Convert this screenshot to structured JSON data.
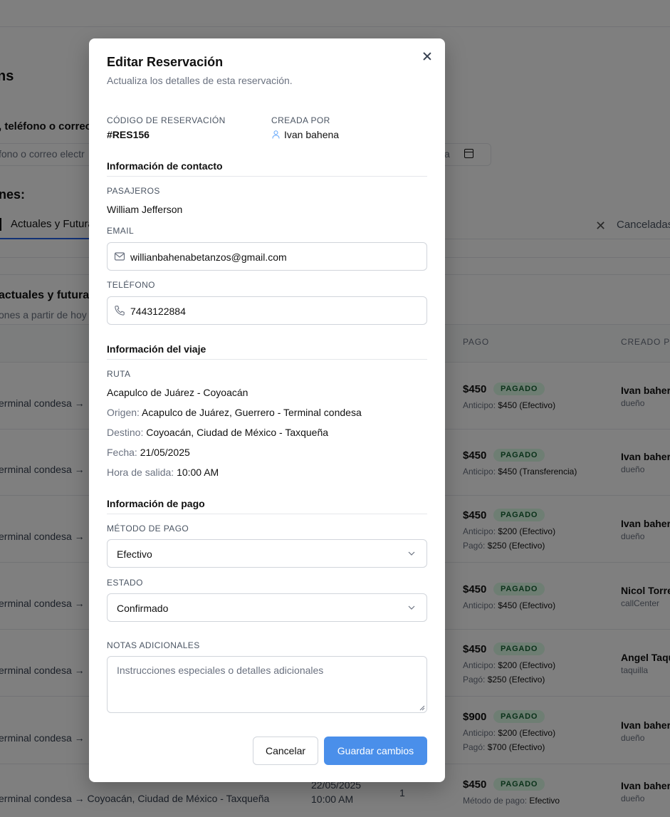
{
  "background": {
    "page_title": "ns",
    "search_label": ", teléfono o correo",
    "search_placeholder": "fono o correo electr",
    "date_fragment": "a",
    "section_label": "nes:",
    "tab_active": "Actuales y Futura",
    "tab_cancelled": "Canceladas",
    "list_title": "actuales y futuras",
    "list_subtitle": "ones a partir de hoy",
    "col_pago": "PAGO",
    "col_creado": "CREADO P",
    "rows": [
      {
        "route": "erminal condesa →",
        "amount": "$450",
        "badge": "PAGADO",
        "pay1_key": "Anticipo:",
        "pay1_val": "$450 (Efectivo)",
        "pay2_key": "",
        "pay2_val": "",
        "creator": "Ivan baher",
        "role": "dueño"
      },
      {
        "route": "erminal condesa →",
        "amount": "$450",
        "badge": "PAGADO",
        "pay1_key": "Anticipo:",
        "pay1_val": "$450 (Transferencia)",
        "pay2_key": "",
        "pay2_val": "",
        "creator": "Ivan baher",
        "role": "dueño"
      },
      {
        "route": "erminal condesa →",
        "amount": "$450",
        "badge": "PAGADO",
        "pay1_key": "Anticipo:",
        "pay1_val": "$200 (Efectivo)",
        "pay2_key": "Pagó:",
        "pay2_val": "$250 (Efectivo)",
        "creator": "Ivan baher",
        "role": "dueño"
      },
      {
        "route": "erminal condesa →",
        "amount": "$450",
        "badge": "PAGADO",
        "pay1_key": "Anticipo:",
        "pay1_val": "$450 (Efectivo)",
        "pay2_key": "",
        "pay2_val": "",
        "creator": "Nicol Torre",
        "role": "callCenter"
      },
      {
        "route": "erminal condesa →",
        "amount": "$450",
        "badge": "PAGADO",
        "pay1_key": "Anticipo:",
        "pay1_val": "$200 (Efectivo)",
        "pay2_key": "Pagó:",
        "pay2_val": "$250 (Efectivo)",
        "creator": "Angel Taqu",
        "role": "taquilla"
      },
      {
        "route": "erminal condesa →",
        "amount": "$900",
        "badge": "PAGADO",
        "pay1_key": "Anticipo:",
        "pay1_val": "$200 (Efectivo)",
        "pay2_key": "Pagó:",
        "pay2_val": "$700 (Efectivo)",
        "creator": "Ivan baher",
        "role": "dueño"
      },
      {
        "route": "erminal condesa → Coyoacán, Ciudad de México - Taxqueña",
        "date": "22/05/2025",
        "time": "10:00 AM",
        "seats": "1",
        "amount": "$450",
        "badge": "PAGADO",
        "pay1_key": "Método de pago:",
        "pay1_val": "Efectivo",
        "pay2_key": "",
        "pay2_val": "",
        "creator": "Ivan baher",
        "role": "dueño"
      }
    ]
  },
  "modal": {
    "title": "Editar Reservación",
    "description": "Actualiza los detalles de esta reservación.",
    "code_label": "CÓDIGO DE RESERVACIÓN",
    "code_value": "#RES156",
    "created_label": "CREADA POR",
    "created_value": "Ivan bahena",
    "contact_section": "Información de contacto",
    "passengers_label": "PASAJEROS",
    "passengers_value": "William Jefferson",
    "email_label": "EMAIL",
    "email_value": "willianbahenabetanzos@gmail.com",
    "phone_label": "TELÉFONO",
    "phone_value": "7443122884",
    "trip_section": "Información del viaje",
    "route_label": "RUTA",
    "route_value": "Acapulco de Juárez - Coyoacán",
    "origin_key": "Origen:",
    "origin_value": "Acapulco de Juárez, Guerrero - Terminal condesa",
    "dest_key": "Destino:",
    "dest_value": "Coyoacán, Ciudad de México - Taxqueña",
    "date_key": "Fecha:",
    "date_value": "21/05/2025",
    "time_key": "Hora de salida:",
    "time_value": "10:00 AM",
    "payment_section": "Información de pago",
    "method_label": "MÉTODO DE PAGO",
    "method_value": "Efectivo",
    "status_label": "ESTADO",
    "status_value": "Confirmado",
    "notes_label": "NOTAS ADICIONALES",
    "notes_placeholder": "Instrucciones especiales o detalles adicionales",
    "cancel_label": "Cancelar",
    "save_label": "Guardar cambios"
  },
  "colors": {
    "primary": "#4a8fea",
    "badge_bg": "#dcfce7",
    "badge_text": "#166534",
    "overlay": "rgba(0,0,0,0.5)"
  }
}
